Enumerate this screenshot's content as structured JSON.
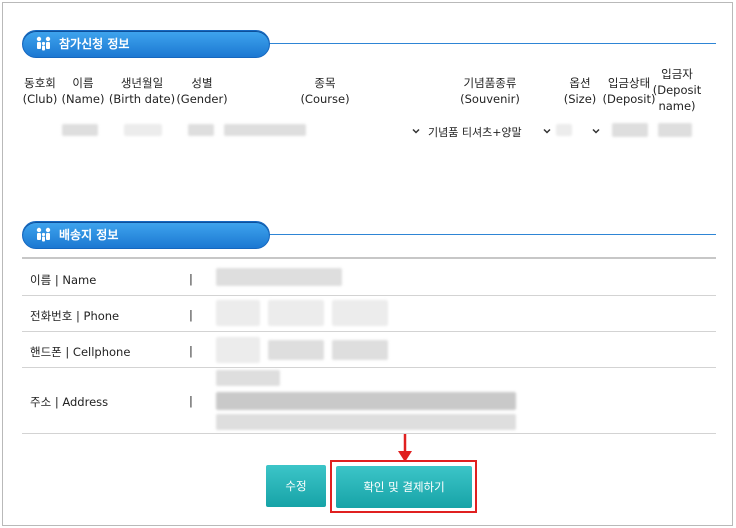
{
  "section_participation": {
    "title": "참가신청 정보",
    "columns": [
      {
        "name": "club",
        "line1": "동호회",
        "line2": "(Club)",
        "line3": ""
      },
      {
        "name": "name",
        "line1": "이름",
        "line2": "(Name)",
        "line3": ""
      },
      {
        "name": "birth-date",
        "line1": "생년월일",
        "line2": "(Birth date)",
        "line3": ""
      },
      {
        "name": "gender",
        "line1": "성별",
        "line2": "(Gender)",
        "line3": ""
      },
      {
        "name": "course",
        "line1": "종목",
        "line2": "(Course)",
        "line3": ""
      },
      {
        "name": "souvenir",
        "line1": "기념품종류",
        "line2": "(Souvenir)",
        "line3": ""
      },
      {
        "name": "size",
        "line1": "옵션",
        "line2": "(Size)",
        "line3": ""
      },
      {
        "name": "deposit",
        "line1": "입금상태",
        "line2": "(Deposit)",
        "line3": ""
      },
      {
        "name": "deposit-name",
        "line1": "입금자",
        "line2": "(Deposit",
        "line3": "name)"
      }
    ],
    "row": {
      "souvenir_value": "기념품 티셔츠+양말"
    }
  },
  "section_shipping": {
    "title": "배송지 정보",
    "fields": [
      {
        "label": "이름 | Name",
        "separator": "|"
      },
      {
        "label": "전화번호 | Phone",
        "separator": "|"
      },
      {
        "label": "핸드폰 | Cellphone",
        "separator": "|"
      },
      {
        "label": "주소 | Address",
        "separator": "|"
      }
    ]
  },
  "buttons": {
    "edit_label": "수정",
    "confirm_label": "확인 및 결제하기"
  },
  "colors": {
    "section_header": "#1c78d2",
    "button": "#17a3a7",
    "highlight": "#e02020"
  },
  "icons": {
    "section": "family-icon",
    "dropdown": "chevron-down-icon",
    "pointer": "arrow-down-icon"
  }
}
